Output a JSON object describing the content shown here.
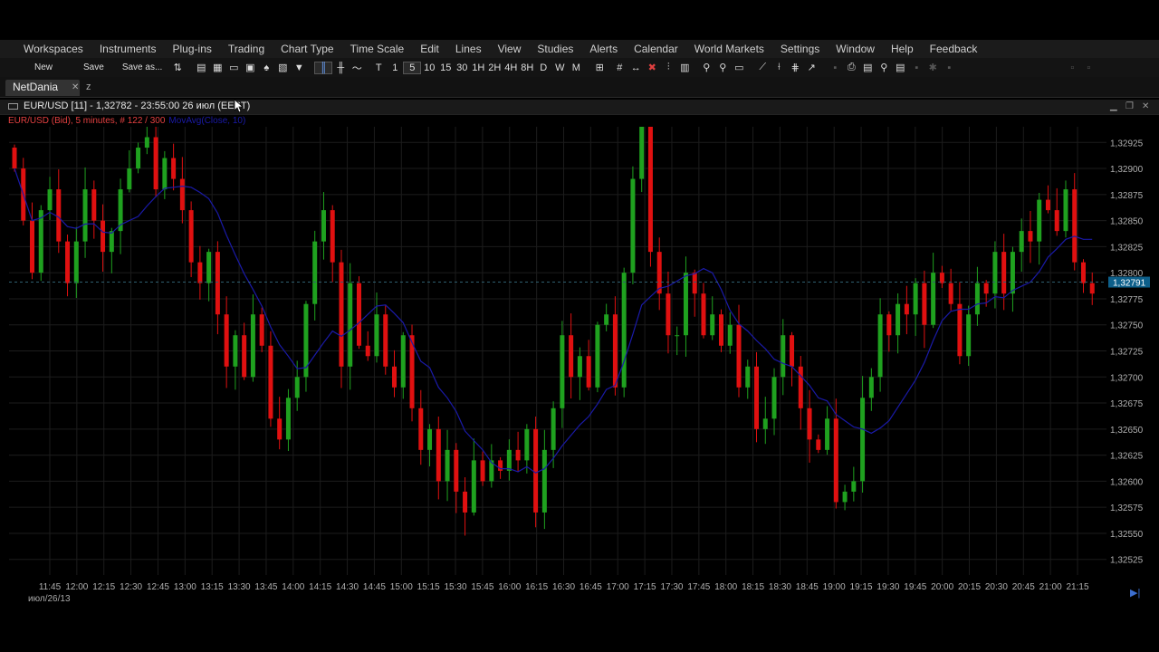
{
  "menubar": {
    "items": [
      "Workspaces",
      "Instruments",
      "Plug-ins",
      "Trading",
      "Chart Type",
      "Time Scale",
      "Edit",
      "Lines",
      "View",
      "Studies",
      "Alerts",
      "Calendar",
      "World Markets",
      "Settings",
      "Window",
      "Help",
      "Feedback"
    ]
  },
  "toolbar": {
    "new_label": "New",
    "save_label": "Save",
    "save_as_label": "Save as...",
    "timeframes": [
      "T",
      "1",
      "5",
      "10",
      "15",
      "30",
      "1H",
      "2H",
      "4H",
      "8H",
      "D",
      "W",
      "M"
    ],
    "active_timeframe": "5"
  },
  "tabs": {
    "active": "NetDania",
    "other": "z"
  },
  "chart_window": {
    "title": "EUR/USD [11] - 1,32782 - 23:55:00  26 июл (EEST)",
    "series_label": "EUR/USD (Bid), 5 minutes, # 122 / 300",
    "ma_label": "MovAvg(Close, 10)"
  },
  "colors": {
    "up": "#1fa11f",
    "down": "#e01010",
    "ma": "#1a1aa8",
    "current_price_bg": "#0d5f8a",
    "grid": "#1c1c1c"
  },
  "chart_data": {
    "type": "candlestick",
    "instrument": "EUR/USD",
    "interval": "5 minutes",
    "y_ticks": [
      "1,32925",
      "1,32900",
      "1,32875",
      "1,32850",
      "1,32825",
      "1,32800",
      "1,32775",
      "1,32750",
      "1,32725",
      "1,32700",
      "1,32675",
      "1,32650",
      "1,32625",
      "1,32600",
      "1,32575",
      "1,32550",
      "1,32525"
    ],
    "ylim": [
      1.3251,
      1.3294
    ],
    "current_price": "1,32791",
    "x_ticks": [
      "11:45",
      "12:00",
      "12:15",
      "12:30",
      "12:45",
      "13:00",
      "13:15",
      "13:30",
      "13:45",
      "14:00",
      "14:15",
      "14:30",
      "14:45",
      "15:00",
      "15:15",
      "15:30",
      "15:45",
      "16:00",
      "16:15",
      "16:30",
      "16:45",
      "17:00",
      "17:15",
      "17:30",
      "17:45",
      "18:00",
      "18:15",
      "18:30",
      "18:45",
      "19:00",
      "19:15",
      "19:30",
      "19:45",
      "20:00",
      "20:15",
      "20:30",
      "20:45",
      "21:00",
      "21:15"
    ],
    "date_label": "июл/26/13",
    "closes": [
      1.329,
      1.3285,
      1.328,
      1.3286,
      1.3288,
      1.3283,
      1.3279,
      1.3283,
      1.3288,
      1.3285,
      1.3282,
      1.3284,
      1.3288,
      1.329,
      1.3292,
      1.3293,
      1.3288,
      1.3291,
      1.3289,
      1.3286,
      1.3281,
      1.3279,
      1.3282,
      1.3276,
      1.3271,
      1.3274,
      1.327,
      1.3276,
      1.3273,
      1.3266,
      1.3264,
      1.3268,
      1.327,
      1.3277,
      1.3283,
      1.3286,
      1.3281,
      1.3271,
      1.3279,
      1.3273,
      1.3272,
      1.3276,
      1.3271,
      1.3269,
      1.3274,
      1.3267,
      1.3263,
      1.3265,
      1.326,
      1.3263,
      1.3259,
      1.3257,
      1.3262,
      1.326,
      1.3262,
      1.3261,
      1.3263,
      1.3262,
      1.3265,
      1.3257,
      1.3263,
      1.3267,
      1.3274,
      1.327,
      1.3272,
      1.3269,
      1.3275,
      1.3276,
      1.3269,
      1.328,
      1.3289,
      1.3295,
      1.3282,
      1.3278,
      1.3274,
      1.3274,
      1.328,
      1.3278,
      1.3274,
      1.3276,
      1.3273,
      1.3275,
      1.3269,
      1.3271,
      1.3265,
      1.3266,
      1.327,
      1.3274,
      1.3271,
      1.3267,
      1.3264,
      1.3263,
      1.3266,
      1.3258,
      1.3259,
      1.326,
      1.3268,
      1.327,
      1.3276,
      1.3274,
      1.3277,
      1.3276,
      1.3279,
      1.3275,
      1.328,
      1.3279,
      1.3277,
      1.3272,
      1.3276,
      1.3279,
      1.3278,
      1.3282,
      1.3278,
      1.3282,
      1.3284,
      1.3283,
      1.3287,
      1.3286,
      1.3284,
      1.3288,
      1.3281,
      1.3279,
      1.3278
    ]
  }
}
